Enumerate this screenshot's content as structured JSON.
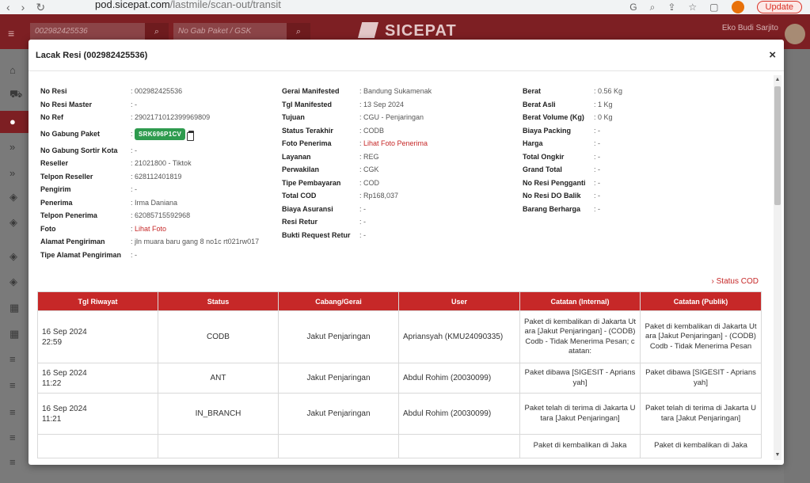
{
  "browser": {
    "host": "pod.sicepat.com",
    "path": "/lastmile/scan-out/transit",
    "update_label": "Update"
  },
  "header": {
    "resi_input": "002982425536",
    "gabung_placeholder": "No Gab Paket / GSK",
    "brand": "SICEPAT",
    "user_name": "Eko Budi Sarjito"
  },
  "modal": {
    "title": "Lacak Resi (002982425536)",
    "close_label": "×",
    "col1": [
      {
        "label": "No Resi",
        "value": "002982425536"
      },
      {
        "label": "No Resi Master",
        "value": "-"
      },
      {
        "label": "No Ref",
        "value": "2902171012399969809"
      },
      {
        "label": "No Gabung Paket",
        "value": "SRK696P1CV"
      },
      {
        "label": "No Gabung Sortir Kota",
        "value": "-"
      },
      {
        "label": "Reseller",
        "value": "21021800 - Tiktok"
      },
      {
        "label": "Telpon Reseller",
        "value": "628112401819"
      },
      {
        "label": "Pengirim",
        "value": "-"
      },
      {
        "label": "Penerima",
        "value": "Irma Daniana"
      },
      {
        "label": "Telpon Penerima",
        "value": "62085715592968"
      },
      {
        "label": "Foto",
        "value": "Lihat Foto"
      },
      {
        "label": "Alamat Pengiriman",
        "value": "jln muara baru gang 8 no1c rt021rw017"
      },
      {
        "label": "Tipe Alamat Pengiriman",
        "value": "-"
      }
    ],
    "col2": [
      {
        "label": "Gerai Manifested",
        "value": "Bandung Sukamenak"
      },
      {
        "label": "Tgl Manifested",
        "value": "13 Sep 2024"
      },
      {
        "label": "Tujuan",
        "value": "CGU - Penjaringan"
      },
      {
        "label": "Status Terakhir",
        "value": "CODB"
      },
      {
        "label": "Foto Penerima",
        "value": "Lihat Foto Penerima"
      },
      {
        "label": "Layanan",
        "value": "REG"
      },
      {
        "label": "Perwakilan",
        "value": "CGK"
      },
      {
        "label": "Tipe Pembayaran",
        "value": "COD"
      },
      {
        "label": "Total COD",
        "value": "Rp168,037"
      },
      {
        "label": "Biaya Asuransi",
        "value": "-"
      },
      {
        "label": "Resi Retur",
        "value": "-"
      },
      {
        "label": "Bukti Request Retur",
        "value": "-"
      }
    ],
    "col3": [
      {
        "label": "Berat",
        "value": "0.56 Kg"
      },
      {
        "label": "Berat Asli",
        "value": "1 Kg"
      },
      {
        "label": "Berat Volume (Kg)",
        "value": "0 Kg"
      },
      {
        "label": "Biaya Packing",
        "value": "-"
      },
      {
        "label": "Harga",
        "value": "-"
      },
      {
        "label": "Total Ongkir",
        "value": "-"
      },
      {
        "label": "Grand Total",
        "value": "-"
      },
      {
        "label": "No Resi Pengganti",
        "value": "-"
      },
      {
        "label": "No Resi DO Balik",
        "value": "-"
      },
      {
        "label": "Barang Berharga",
        "value": "-"
      }
    ],
    "status_cod_link": "› Status COD",
    "table": {
      "headers": [
        "Tgl Riwayat",
        "Status",
        "Cabang/Gerai",
        "User",
        "Catatan (Internal)",
        "Catatan (Publik)"
      ],
      "rows": [
        {
          "date": "16 Sep 2024",
          "time": "22:59",
          "status": "CODB",
          "branch": "Jakut Penjaringan",
          "user": "Apriansyah (KMU24090335)",
          "internal": "Paket di kembalikan di Jakarta Utara [Jakut Penjaringan] - (CODB) Codb - Tidak Menerima Pesan; catatan:",
          "public": "Paket di kembalikan di Jakarta Utara [Jakut Penjaringan] - (CODB) Codb - Tidak Menerima Pesan"
        },
        {
          "date": "16 Sep 2024",
          "time": "11:22",
          "status": "ANT",
          "branch": "Jakut Penjaringan",
          "user": "Abdul Rohim (20030099)",
          "internal": "Paket dibawa [SIGESIT - Apriansyah]",
          "public": "Paket dibawa [SIGESIT - Apriansyah]"
        },
        {
          "date": "16 Sep 2024",
          "time": "11:21",
          "status": "IN_BRANCH",
          "branch": "Jakut Penjaringan",
          "user": "Abdul Rohim (20030099)",
          "internal": "Paket telah di terima di Jakarta Utara [Jakut Penjaringan]",
          "public": "Paket telah di terima di Jakarta Utara [Jakut Penjaringan]"
        },
        {
          "date": "",
          "time": "",
          "status": "",
          "branch": "",
          "user": "",
          "internal": "Paket di kembalikan di Jaka",
          "public": "Paket di kembalikan di Jaka"
        }
      ]
    }
  }
}
